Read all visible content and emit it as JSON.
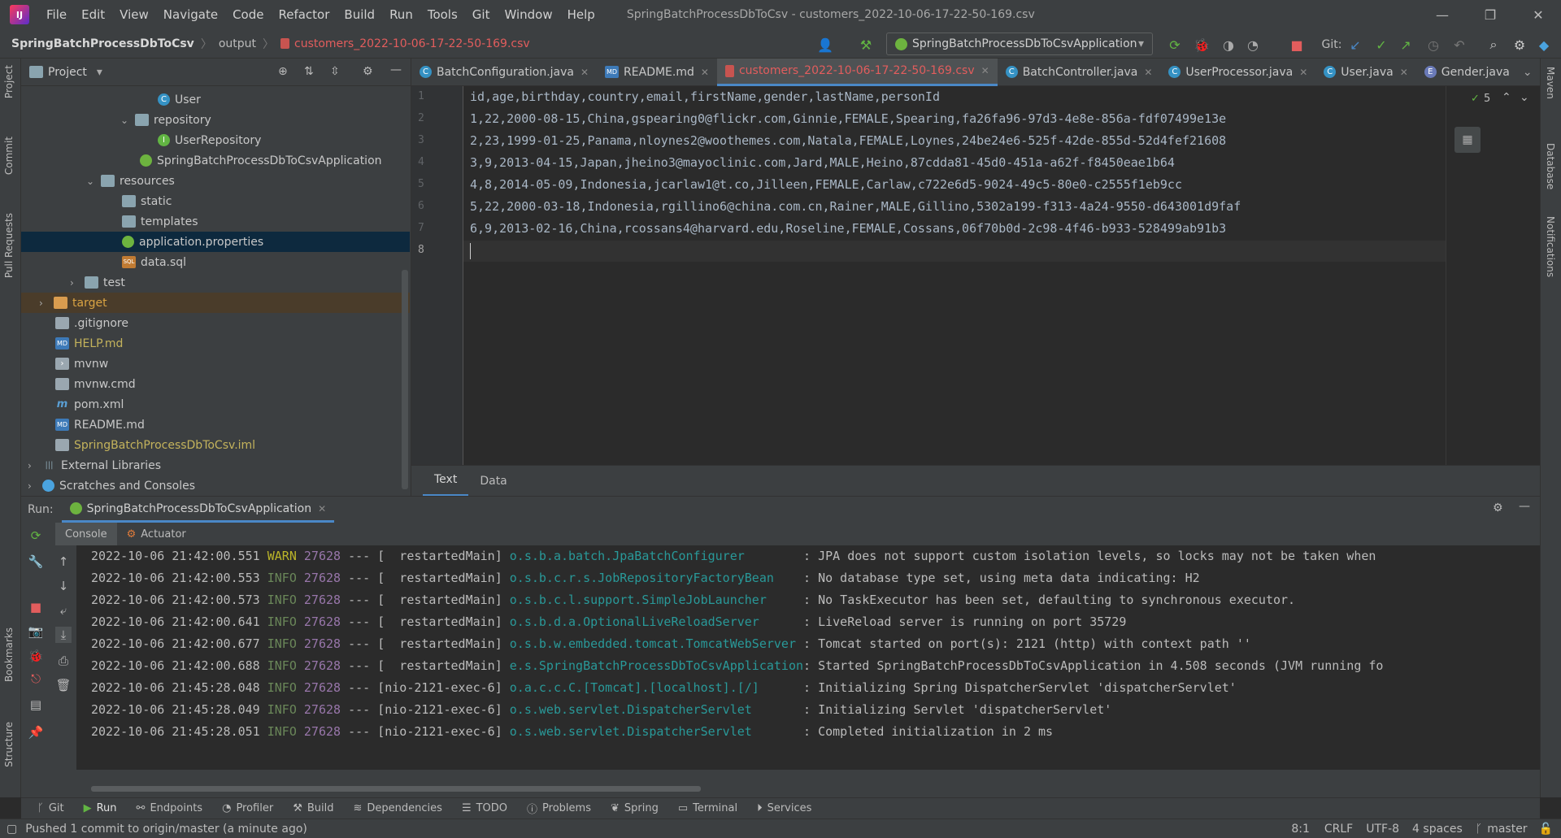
{
  "app": {
    "logo_text": "IJ",
    "title": "SpringBatchProcessDbToCsv - customers_2022-10-06-17-22-50-169.csv"
  },
  "menu": [
    "File",
    "Edit",
    "View",
    "Navigate",
    "Code",
    "Refactor",
    "Build",
    "Run",
    "Tools",
    "Git",
    "Window",
    "Help"
  ],
  "breadcrumb": {
    "project": "SpringBatchProcessDbToCsv",
    "folder": "output",
    "file": "customers_2022-10-06-17-22-50-169.csv"
  },
  "toolbar": {
    "run_config": "SpringBatchProcessDbToCsvApplication",
    "git_label": "Git:"
  },
  "left_strip": {
    "project": "Project",
    "commit": "Commit",
    "pull_requests": "Pull Requests",
    "bookmarks": "Bookmarks",
    "structure": "Structure"
  },
  "right_strip": {
    "maven": "Maven",
    "database": "Database",
    "notifications": "Notifications"
  },
  "project_panel": {
    "title": "Project",
    "items": [
      {
        "label": "User",
        "icon": "class-icon"
      },
      {
        "label": "repository",
        "icon": "folder-icon"
      },
      {
        "label": "UserRepository",
        "icon": "interface-icon"
      },
      {
        "label": "SpringBatchProcessDbToCsvApplication",
        "icon": "spring-app-icon"
      },
      {
        "label": "resources",
        "icon": "folder-icon"
      },
      {
        "label": "static",
        "icon": "folder-icon"
      },
      {
        "label": "templates",
        "icon": "folder-icon"
      },
      {
        "label": "application.properties",
        "icon": "properties-icon"
      },
      {
        "label": "data.sql",
        "icon": "sql-icon"
      },
      {
        "label": "test",
        "icon": "folder-icon"
      },
      {
        "label": "target",
        "icon": "folder-excluded-icon"
      },
      {
        "label": ".gitignore",
        "icon": "file-icon"
      },
      {
        "label": "HELP.md",
        "icon": "markdown-icon"
      },
      {
        "label": "mvnw",
        "icon": "file-icon"
      },
      {
        "label": "mvnw.cmd",
        "icon": "file-icon"
      },
      {
        "label": "pom.xml",
        "icon": "maven-icon"
      },
      {
        "label": "README.md",
        "icon": "markdown-icon"
      },
      {
        "label": "SpringBatchProcessDbToCsv.iml",
        "icon": "module-icon"
      },
      {
        "label": "External Libraries",
        "icon": "library-icon"
      },
      {
        "label": "Scratches and Consoles",
        "icon": "scratch-icon"
      }
    ]
  },
  "editor_tabs": [
    {
      "label": "BatchConfiguration.java",
      "icon": "class-icon"
    },
    {
      "label": "README.md",
      "icon": "markdown-icon"
    },
    {
      "label": "customers_2022-10-06-17-22-50-169.csv",
      "icon": "csv-icon"
    },
    {
      "label": "BatchController.java",
      "icon": "class-icon"
    },
    {
      "label": "UserProcessor.java",
      "icon": "class-icon"
    },
    {
      "label": "User.java",
      "icon": "class-icon"
    },
    {
      "label": "Gender.java",
      "icon": "enum-icon"
    }
  ],
  "editor": {
    "line_numbers": [
      "1",
      "2",
      "3",
      "4",
      "5",
      "6",
      "7",
      "8"
    ],
    "lines": [
      "id,age,birthday,country,email,firstName,gender,lastName,personId",
      "1,22,2000-08-15,China,gspearing0@flickr.com,Ginnie,FEMALE,Spearing,fa26fa96-97d3-4e8e-856a-fdf07499e13e",
      "2,23,1999-01-25,Panama,nloynes2@woothemes.com,Natala,FEMALE,Loynes,24be24e6-525f-42de-855d-52d4fef21608",
      "3,9,2013-04-15,Japan,jheino3@mayoclinic.com,Jard,MALE,Heino,87cdda81-45d0-451a-a62f-f8450eae1b64",
      "4,8,2014-05-09,Indonesia,jcarlaw1@t.co,Jilleen,FEMALE,Carlaw,c722e6d5-9024-49c5-80e0-c2555f1eb9cc",
      "5,22,2000-03-18,Indonesia,rgillino6@china.com.cn,Rainer,MALE,Gillino,5302a199-f313-4a24-9550-d643001d9faf",
      "6,9,2013-02-16,China,rcossans4@harvard.edu,Roseline,FEMALE,Cossans,06f70b0d-2c98-4f46-b933-528499ab91b3",
      ""
    ],
    "inspection_count": "5",
    "view_tabs": [
      "Text",
      "Data"
    ]
  },
  "run_panel": {
    "run_label": "Run:",
    "run_tab": "SpringBatchProcessDbToCsvApplication",
    "console_tabs": [
      "Console",
      "Actuator"
    ],
    "logs": [
      {
        "ts": "2022-10-06 21:42:00.551",
        "level": "WARN",
        "pid": "27628",
        "thread": "--- [  restartedMain]",
        "logger": "o.s.b.a.batch.JpaBatchConfigurer       ",
        "msg": " : JPA does not support custom isolation levels, so locks may not be taken when"
      },
      {
        "ts": "2022-10-06 21:42:00.553",
        "level": "INFO",
        "pid": "27628",
        "thread": "--- [  restartedMain]",
        "logger": "o.s.b.c.r.s.JobRepositoryFactoryBean   ",
        "msg": " : No database type set, using meta data indicating: H2"
      },
      {
        "ts": "2022-10-06 21:42:00.573",
        "level": "INFO",
        "pid": "27628",
        "thread": "--- [  restartedMain]",
        "logger": "o.s.b.c.l.support.SimpleJobLauncher    ",
        "msg": " : No TaskExecutor has been set, defaulting to synchronous executor."
      },
      {
        "ts": "2022-10-06 21:42:00.641",
        "level": "INFO",
        "pid": "27628",
        "thread": "--- [  restartedMain]",
        "logger": "o.s.b.d.a.OptionalLiveReloadServer     ",
        "msg": " : LiveReload server is running on port 35729"
      },
      {
        "ts": "2022-10-06 21:42:00.677",
        "level": "INFO",
        "pid": "27628",
        "thread": "--- [  restartedMain]",
        "logger": "o.s.b.w.embedded.tomcat.TomcatWebServer",
        "msg": " : Tomcat started on port(s): 2121 (http) with context path ''"
      },
      {
        "ts": "2022-10-06 21:42:00.688",
        "level": "INFO",
        "pid": "27628",
        "thread": "--- [  restartedMain]",
        "logger": "e.s.SpringBatchProcessDbToCsvApplication",
        "msg": ": Started SpringBatchProcessDbToCsvApplication in 4.508 seconds (JVM running fo"
      },
      {
        "ts": "2022-10-06 21:45:28.048",
        "level": "INFO",
        "pid": "27628",
        "thread": "--- [nio-2121-exec-6]",
        "logger": "o.a.c.c.C.[Tomcat].[localhost].[/]     ",
        "msg": " : Initializing Spring DispatcherServlet 'dispatcherServlet'"
      },
      {
        "ts": "2022-10-06 21:45:28.049",
        "level": "INFO",
        "pid": "27628",
        "thread": "--- [nio-2121-exec-6]",
        "logger": "o.s.web.servlet.DispatcherServlet      ",
        "msg": " : Initializing Servlet 'dispatcherServlet'"
      },
      {
        "ts": "2022-10-06 21:45:28.051",
        "level": "INFO",
        "pid": "27628",
        "thread": "--- [nio-2121-exec-6]",
        "logger": "o.s.web.servlet.DispatcherServlet      ",
        "msg": " : Completed initialization in 2 ms"
      }
    ]
  },
  "tool_windows": [
    "Git",
    "Run",
    "Endpoints",
    "Profiler",
    "Build",
    "Dependencies",
    "TODO",
    "Problems",
    "Spring",
    "Terminal",
    "Services"
  ],
  "status": {
    "message": "Pushed 1 commit to origin/master (a minute ago)",
    "position": "8:1",
    "line_sep": "CRLF",
    "encoding": "UTF-8",
    "indent": "4 spaces",
    "branch": "master"
  },
  "colors": {
    "accent": "#4a88c7",
    "error": "#e25d5d",
    "warn": "#bbb529",
    "info": "#6a8759",
    "logger": "#299999",
    "pid": "#9876aa"
  }
}
